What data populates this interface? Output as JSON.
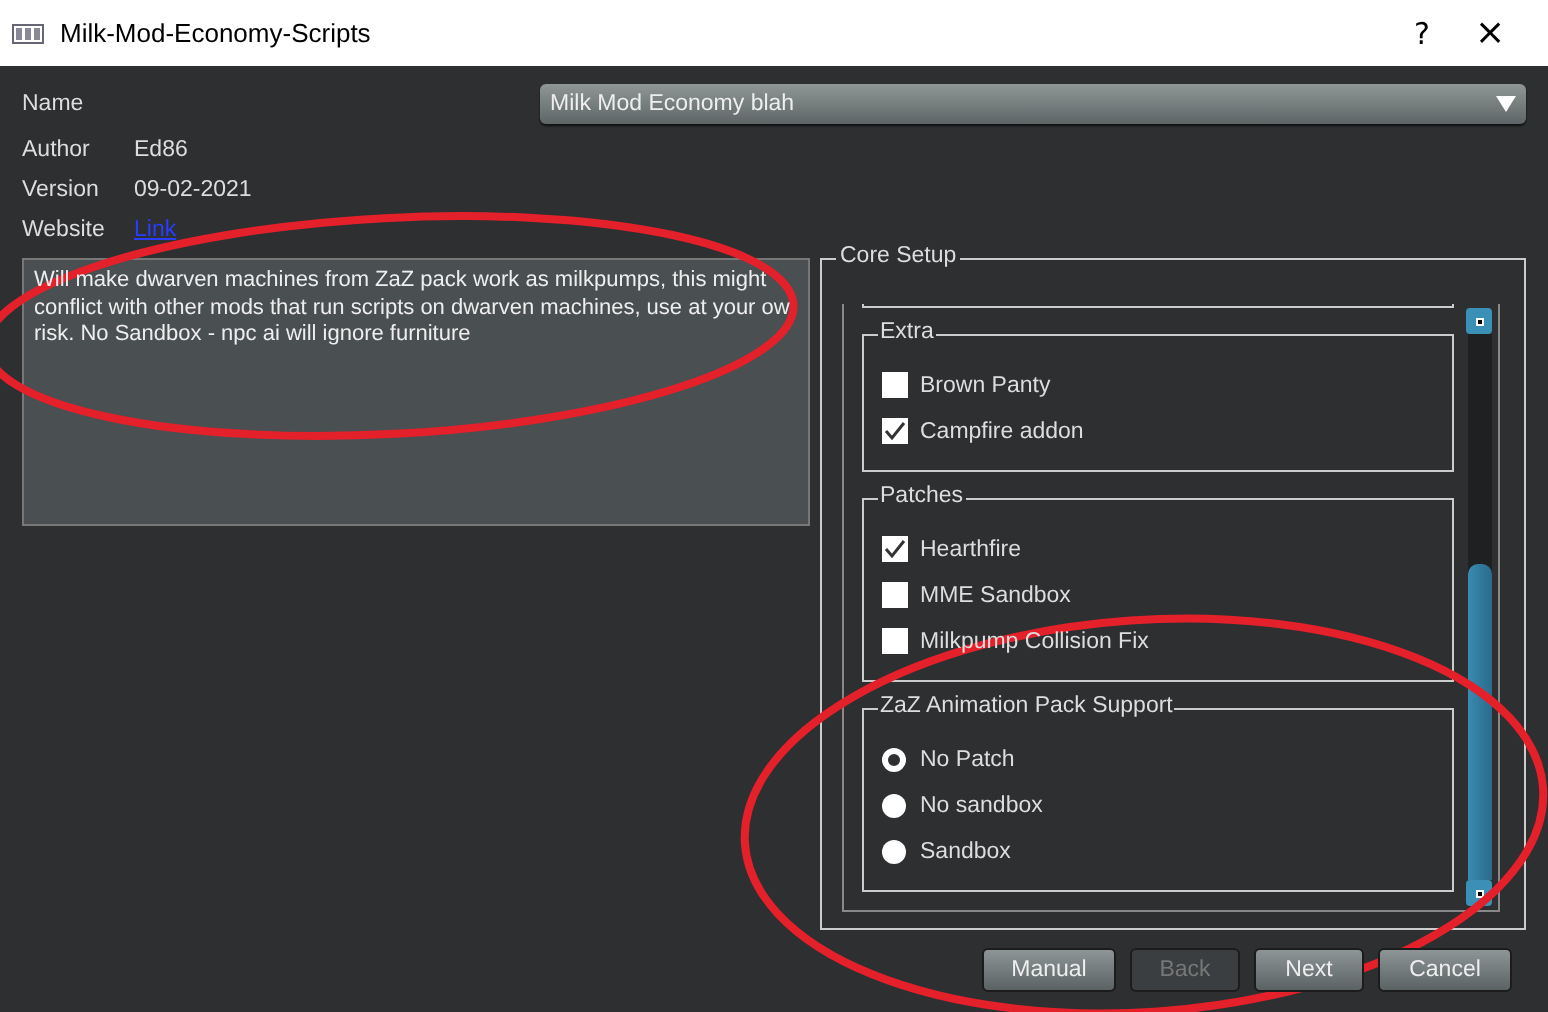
{
  "window": {
    "title": "Milk-Mod-Economy-Scripts",
    "help": "?",
    "close": "×"
  },
  "fields": [
    {
      "label": "Name",
      "kind": "combo",
      "value": "Milk Mod Economy blah"
    },
    {
      "label": "Author",
      "kind": "text",
      "value": "Ed86"
    },
    {
      "label": "Version",
      "kind": "text",
      "value": "09-02-2021"
    },
    {
      "label": "Website",
      "kind": "link",
      "value": "Link"
    }
  ],
  "description": "Will make dwarven machines from ZaZ pack work as milkpumps, this might\nconflict with other mods that run scripts on dwarven machines, use at your ow\nrisk. No Sandbox - npc ai will ignore furniture",
  "core_setup": {
    "title": "Core Setup",
    "groups": [
      {
        "title": "Extra",
        "options": [
          {
            "kind": "checkbox",
            "label": "Brown Panty",
            "checked": false
          },
          {
            "kind": "checkbox",
            "label": "Campfire addon",
            "checked": true
          }
        ]
      },
      {
        "title": "Patches",
        "options": [
          {
            "kind": "checkbox",
            "label": "Hearthfire",
            "checked": true
          },
          {
            "kind": "checkbox",
            "label": "MME Sandbox",
            "checked": false
          },
          {
            "kind": "checkbox",
            "label": "Milkpump Collision Fix",
            "checked": false
          }
        ]
      },
      {
        "title": "ZaZ Animation Pack Support",
        "options": [
          {
            "kind": "radio",
            "label": "No Patch",
            "selected": true
          },
          {
            "kind": "radio",
            "label": "No sandbox",
            "selected": false
          },
          {
            "kind": "radio",
            "label": "Sandbox",
            "selected": false
          }
        ]
      }
    ]
  },
  "buttons": [
    {
      "label": "Manual",
      "disabled": false
    },
    {
      "label": "Back",
      "disabled": true
    },
    {
      "label": "Next",
      "disabled": false
    },
    {
      "label": "Cancel",
      "disabled": false
    }
  ]
}
